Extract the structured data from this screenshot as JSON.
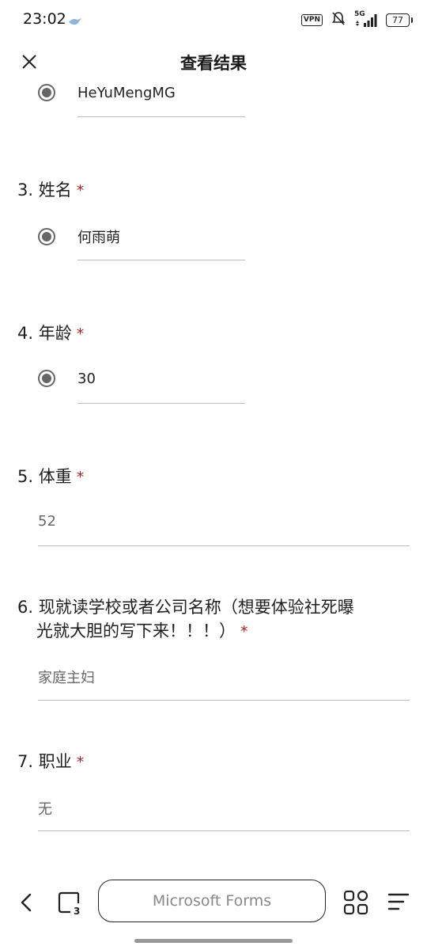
{
  "status_bar": {
    "time": "23:02",
    "vpn": "VPN",
    "network": "5G",
    "battery": "77"
  },
  "header": {
    "title": "查看结果"
  },
  "questions": {
    "q2_answer": "HeYuMengMG",
    "q3": {
      "title": "3. 姓名",
      "required": "*",
      "answer": "何雨萌"
    },
    "q4": {
      "title": "4. 年龄",
      "required": "*",
      "answer": "30"
    },
    "q5": {
      "title": "5. 体重",
      "required": "*",
      "answer": "52"
    },
    "q6": {
      "title_line1": "6. 现就读学校或者公司名称（想要体验社死曝",
      "title_line2": "光就大胆的写下来！！！）",
      "required": "*",
      "answer": "家庭主妇"
    },
    "q7": {
      "title": "7. 职业",
      "required": "*",
      "answer": "无"
    }
  },
  "bottom_nav": {
    "address": "Microsoft Forms"
  },
  "colors": {
    "required": "#a4262c",
    "radio": "#666666",
    "divider": "#bdbdbd"
  }
}
